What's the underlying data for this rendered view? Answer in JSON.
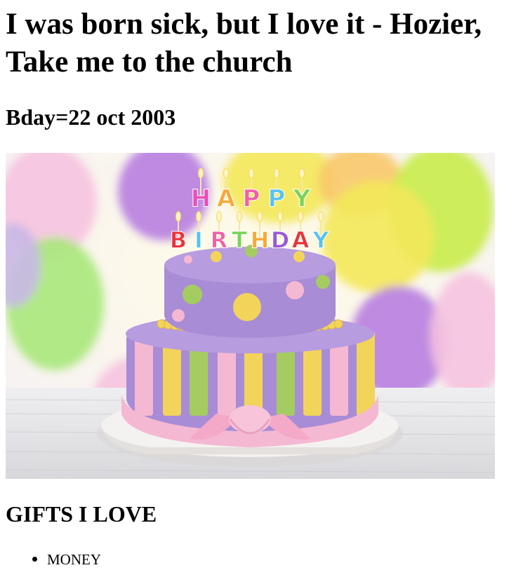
{
  "heading": {
    "title": "I was born sick, but I love it - Hozier, Take me to the church"
  },
  "bday": {
    "text": "Bday=22 oct 2003"
  },
  "cake_image": {
    "happy_letters": [
      "H",
      "A",
      "P",
      "P",
      "Y"
    ],
    "birthday_letters": [
      "B",
      "I",
      "R",
      "T",
      "H",
      "D",
      "A",
      "Y"
    ],
    "happy_colors": [
      "#e84fb8",
      "#f6a93a",
      "#f35fa6",
      "#58c3ef",
      "#7bd35a"
    ],
    "birthday_colors": [
      "#e8343a",
      "#58c3ef",
      "#f35fa6",
      "#7bd35a",
      "#f6a93a",
      "#9b59d6",
      "#e8343a",
      "#58c3ef"
    ],
    "balloon_colors": {
      "purple": "#b77ee0",
      "green": "#c8ec4a",
      "yellow": "#f3e85a",
      "pink": "#f6c3df",
      "lime": "#a8e87a"
    },
    "cake_colors": {
      "lavender": "#a98cd6",
      "lavender_dark": "#8e74c6",
      "yellow": "#f3d45a",
      "green": "#a5cc61",
      "pink": "#f5b8d2",
      "plate": "#f2f0ee"
    }
  },
  "gifts": {
    "heading": "GIFTS I LOVE",
    "items": [
      "MONEY"
    ]
  }
}
